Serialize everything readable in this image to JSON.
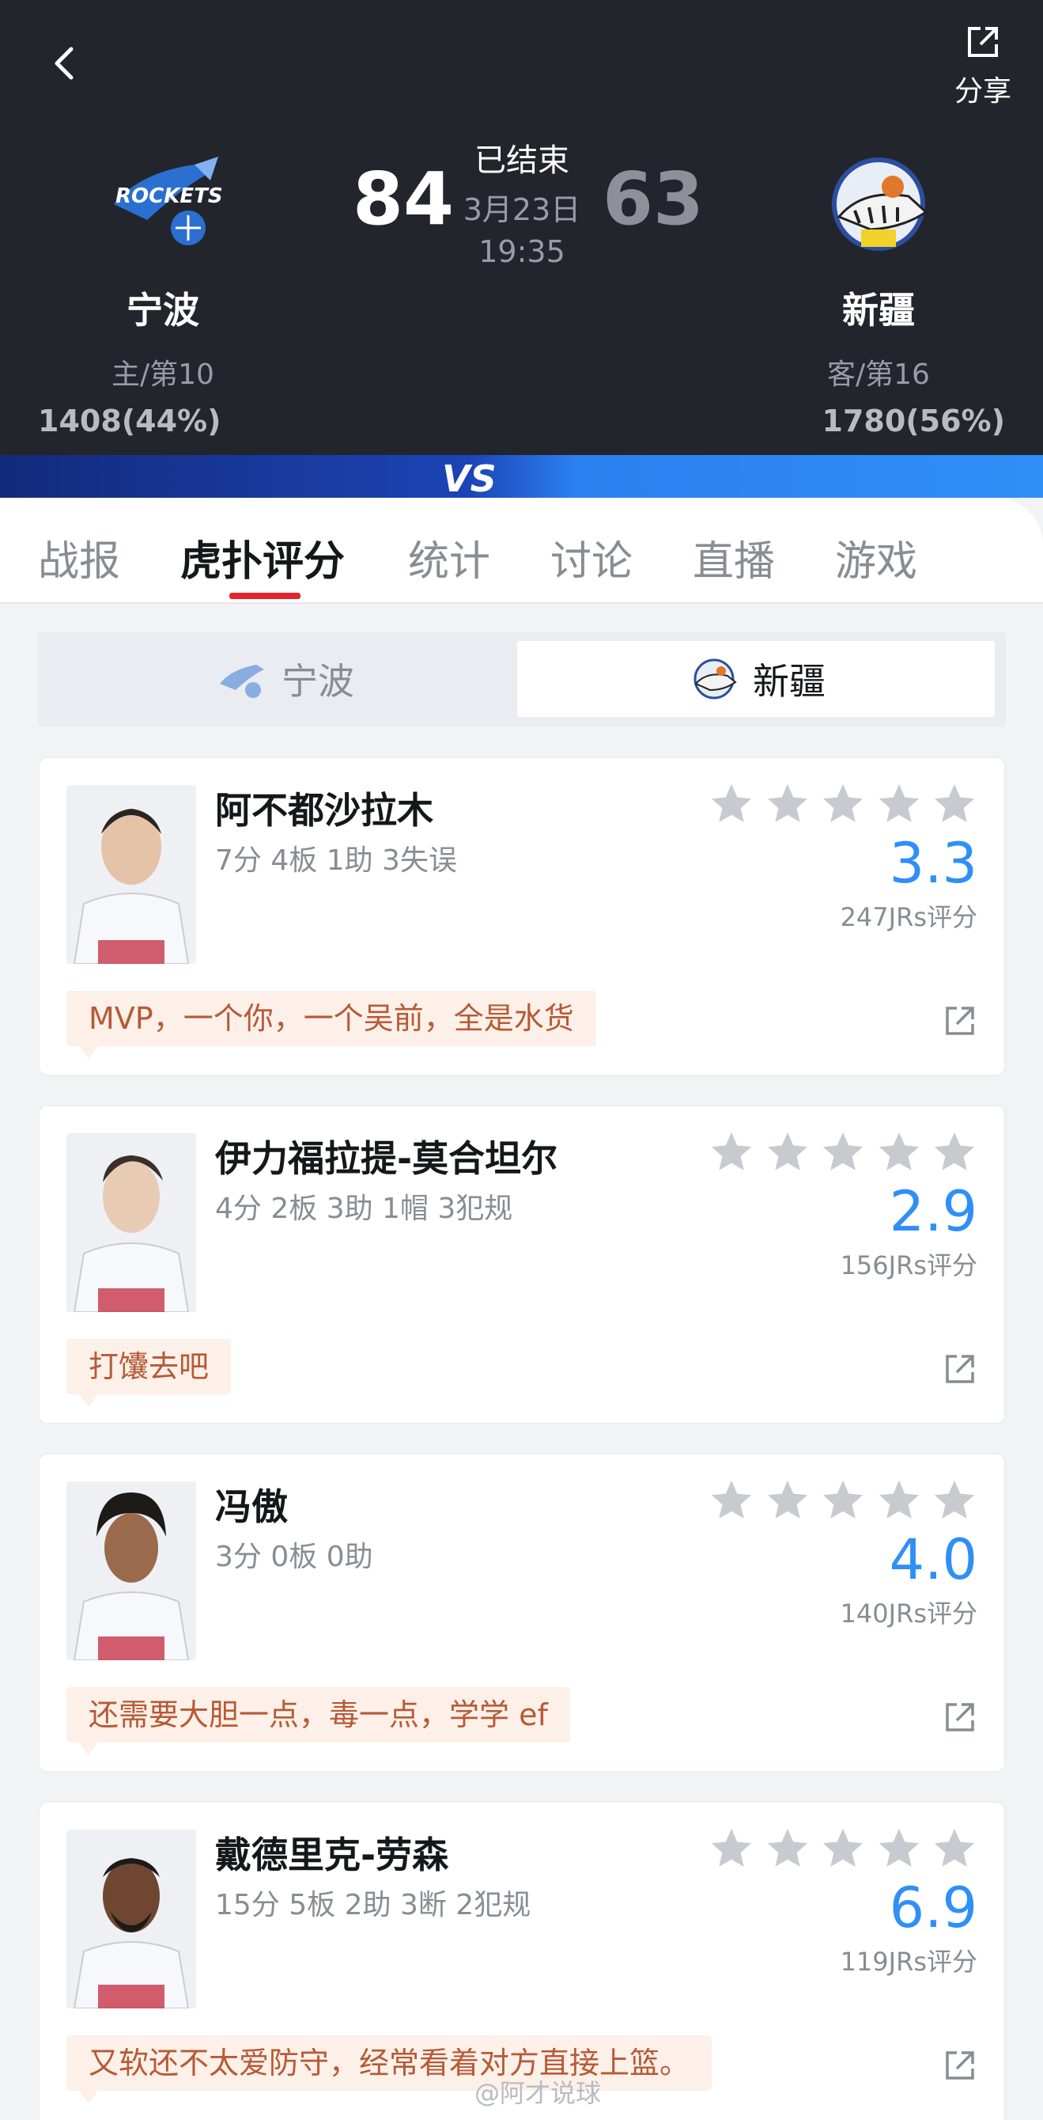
{
  "header": {
    "share_label": "分享",
    "status": "已结束",
    "date": "3月23日",
    "time": "19:35",
    "home": {
      "name": "宁波",
      "rank": "主/第10",
      "score": "84",
      "support": "1408(44%)",
      "logo": "rockets-logo"
    },
    "away": {
      "name": "新疆",
      "rank": "客/第16",
      "score": "63",
      "support": "1780(56%)",
      "logo": "flying-tigers-logo"
    }
  },
  "tabs": [
    "战报",
    "虎扑评分",
    "统计",
    "讨论",
    "直播",
    "游戏"
  ],
  "active_tab": "虎扑评分",
  "team_switch": {
    "left": "宁波",
    "right": "新疆",
    "selected": "新疆"
  },
  "players": [
    {
      "name": "阿不都沙拉木",
      "stats": "7分 4板 1助 3失误",
      "rating": "3.3",
      "raters": "247JRs评分",
      "comment": "MVP，一个你，一个吴前，全是水货"
    },
    {
      "name": "伊力福拉提-莫合坦尔",
      "stats": "4分 2板 3助 1帽 3犯规",
      "rating": "2.9",
      "raters": "156JRs评分",
      "comment": "打馕去吧"
    },
    {
      "name": "冯傲",
      "stats": "3分 0板 0助",
      "rating": "4.0",
      "raters": "140JRs评分",
      "comment": "还需要大胆一点，毒一点，学学 ef"
    },
    {
      "name": "戴德里克-劳森",
      "stats": "15分 5板 2助 3断 2犯规",
      "rating": "6.9",
      "raters": "119JRs评分",
      "comment": "又软还不太爱防守，经常看着对方直接上篮。"
    }
  ],
  "watermark": "@阿才说球",
  "colors": {
    "header_bg": "#23252d",
    "accent_red": "#e3252f",
    "rating_blue": "#2f8ff7",
    "comment_text": "#b65a36",
    "comment_bg": "#fdf0e8"
  }
}
